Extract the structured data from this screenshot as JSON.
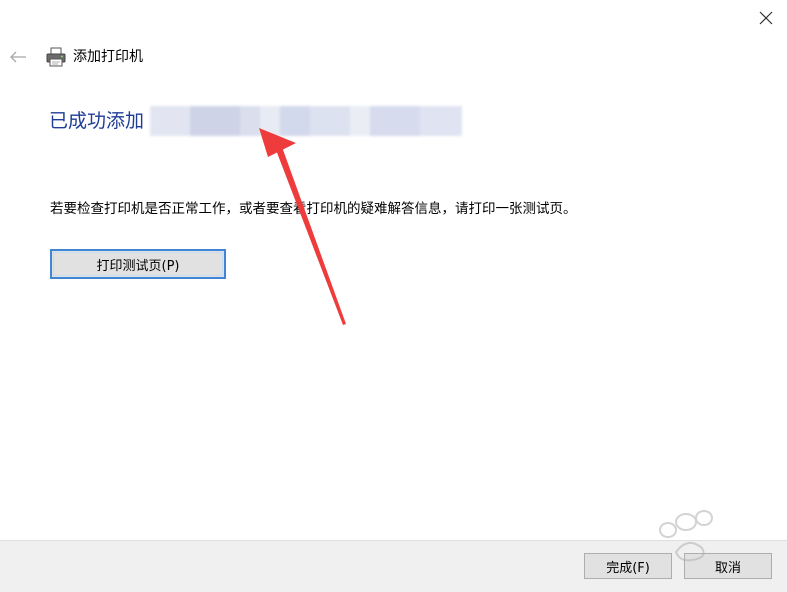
{
  "window": {
    "title": "添加打印机",
    "close_icon": "close-icon",
    "back_icon": "back-arrow-icon",
    "printer_icon": "printer-icon"
  },
  "main": {
    "heading": "已成功添加",
    "description": "若要检查打印机是否正常工作，或者要查看打印机的疑难解答信息，请打印一张测试页。",
    "test_page_button": "打印测试页(P)"
  },
  "footer": {
    "finish_button": "完成(F)",
    "cancel_button": "取消"
  },
  "annotation": {
    "arrow_color": "#ee3b3b"
  },
  "colors": {
    "heading": "#1f3d96",
    "focus_border": "#3f86d6",
    "footer_bg": "#f0f0f0"
  }
}
